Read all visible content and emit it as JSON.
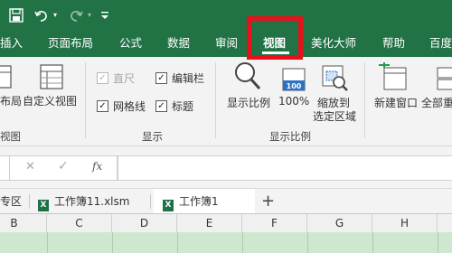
{
  "colors": {
    "brand_green": "#217346",
    "highlight_red": "#e8101a",
    "active_tab_text": "#217346"
  },
  "quick_access": {
    "icons": [
      "save-icon",
      "undo-icon",
      "dropdown-icon",
      "redo-icon",
      "dropdown-icon",
      "customize-icon"
    ]
  },
  "tabs": [
    {
      "label": "插入"
    },
    {
      "label": "页面布局"
    },
    {
      "label": "公式"
    },
    {
      "label": "数据"
    },
    {
      "label": "审阅"
    },
    {
      "label": "视图",
      "active": true
    },
    {
      "label": "美化大师"
    },
    {
      "label": "帮助"
    },
    {
      "label": "百度"
    }
  ],
  "ribbon": {
    "workbook_views": {
      "layout_label": "布局",
      "custom_view_label": "自定义视图",
      "group_title": "视图"
    },
    "show": {
      "ruler": "直尺",
      "ruler_checked": true,
      "ruler_disabled": true,
      "formula_bar": "编辑栏",
      "formula_bar_checked": true,
      "gridlines": "网格线",
      "gridlines_checked": true,
      "headings": "标题",
      "headings_checked": true,
      "group_title": "显示"
    },
    "zoom": {
      "zoom_label": "显示比例",
      "percent_label": "100%",
      "fit_label_line1": "缩放到",
      "fit_label_line2": "选定区域",
      "group_title": "显示比例"
    },
    "window": {
      "new_window_label": "新建窗口",
      "arrange_all_label": "全部重"
    }
  },
  "formula_bar": {
    "cancel": "✕",
    "enter": "✓",
    "fx": "fx",
    "value": ""
  },
  "sheet_tabs": {
    "partial_label": "专区",
    "workbook1": "工作簿11.xlsm",
    "workbook2": "工作簿1",
    "add": "+"
  },
  "columns": [
    "B",
    "C",
    "D",
    "E",
    "F",
    "G",
    "H"
  ]
}
